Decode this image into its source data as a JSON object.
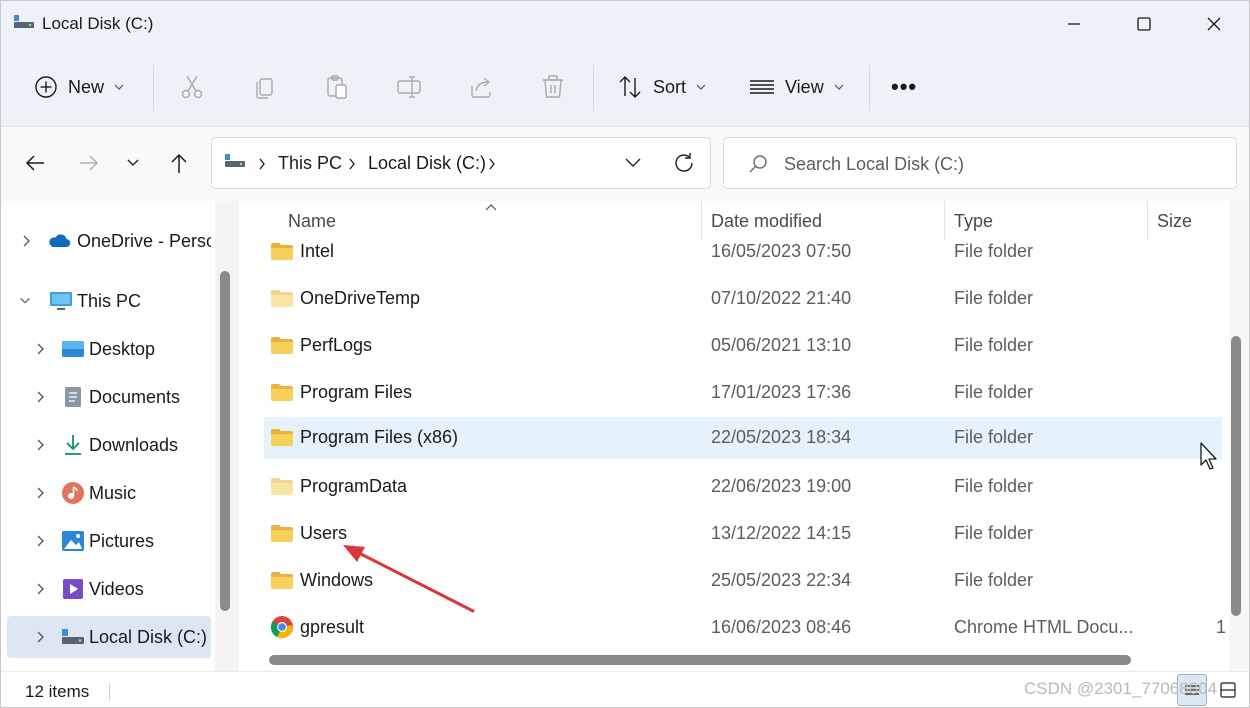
{
  "window": {
    "title": "Local Disk (C:)",
    "controls": [
      "minimize",
      "maximize",
      "close"
    ]
  },
  "toolbar": {
    "new_label": "New",
    "sort_label": "Sort",
    "view_label": "View",
    "icons": [
      "cut-icon",
      "copy-icon",
      "paste-icon",
      "rename-icon",
      "share-icon",
      "delete-icon"
    ],
    "more_label": "•••"
  },
  "navigation": {
    "breadcrumb": [
      "This PC",
      "Local Disk (C:)"
    ],
    "search_placeholder": "Search Local Disk (C:)"
  },
  "sidebar": {
    "items": [
      {
        "label": "OneDrive - Personal",
        "icon": "onedrive-icon",
        "expanded": false,
        "indent": 0
      },
      {
        "label": "This PC",
        "icon": "pc-icon",
        "expanded": true,
        "indent": 0
      },
      {
        "label": "Desktop",
        "icon": "desktop-icon",
        "expanded": false,
        "indent": 1
      },
      {
        "label": "Documents",
        "icon": "documents-icon",
        "expanded": false,
        "indent": 1
      },
      {
        "label": "Downloads",
        "icon": "downloads-icon",
        "expanded": false,
        "indent": 1
      },
      {
        "label": "Music",
        "icon": "music-icon",
        "expanded": false,
        "indent": 1
      },
      {
        "label": "Pictures",
        "icon": "pictures-icon",
        "expanded": false,
        "indent": 1
      },
      {
        "label": "Videos",
        "icon": "videos-icon",
        "expanded": false,
        "indent": 1
      },
      {
        "label": "Local Disk (C:)",
        "icon": "drive-icon",
        "expanded": false,
        "indent": 1,
        "selected": true
      }
    ]
  },
  "columns": {
    "name": "Name",
    "date": "Date modified",
    "type": "Type",
    "size": "Size"
  },
  "files": [
    {
      "name": "Intel",
      "date": "16/05/2023 07:50",
      "type": "File folder",
      "size": "",
      "icon": "folder-icon"
    },
    {
      "name": "OneDriveTemp",
      "date": "07/10/2022 21:40",
      "type": "File folder",
      "size": "",
      "icon": "folder-icon"
    },
    {
      "name": "PerfLogs",
      "date": "05/06/2021 13:10",
      "type": "File folder",
      "size": "",
      "icon": "folder-icon"
    },
    {
      "name": "Program Files",
      "date": "17/01/2023 17:36",
      "type": "File folder",
      "size": "",
      "icon": "folder-icon"
    },
    {
      "name": "Program Files (x86)",
      "date": "22/05/2023 18:34",
      "type": "File folder",
      "size": "",
      "icon": "folder-icon",
      "hover": true
    },
    {
      "name": "ProgramData",
      "date": "22/06/2023 19:00",
      "type": "File folder",
      "size": "",
      "icon": "folder-icon"
    },
    {
      "name": "Users",
      "date": "13/12/2022 14:15",
      "type": "File folder",
      "size": "",
      "icon": "folder-icon"
    },
    {
      "name": "Windows",
      "date": "25/05/2023 22:34",
      "type": "File folder",
      "size": "",
      "icon": "folder-icon"
    },
    {
      "name": "gpresult",
      "date": "16/06/2023 08:46",
      "type": "Chrome HTML Docu...",
      "size": "1",
      "icon": "chrome-icon"
    }
  ],
  "status": {
    "item_count": "12 items"
  },
  "watermark": "CSDN @2301_77068804",
  "colors": {
    "accent": "#0067c0",
    "folder": "#f5c748",
    "selection": "#dde7f3",
    "hover": "#e5f1fb",
    "annotation": "#d9373a"
  }
}
